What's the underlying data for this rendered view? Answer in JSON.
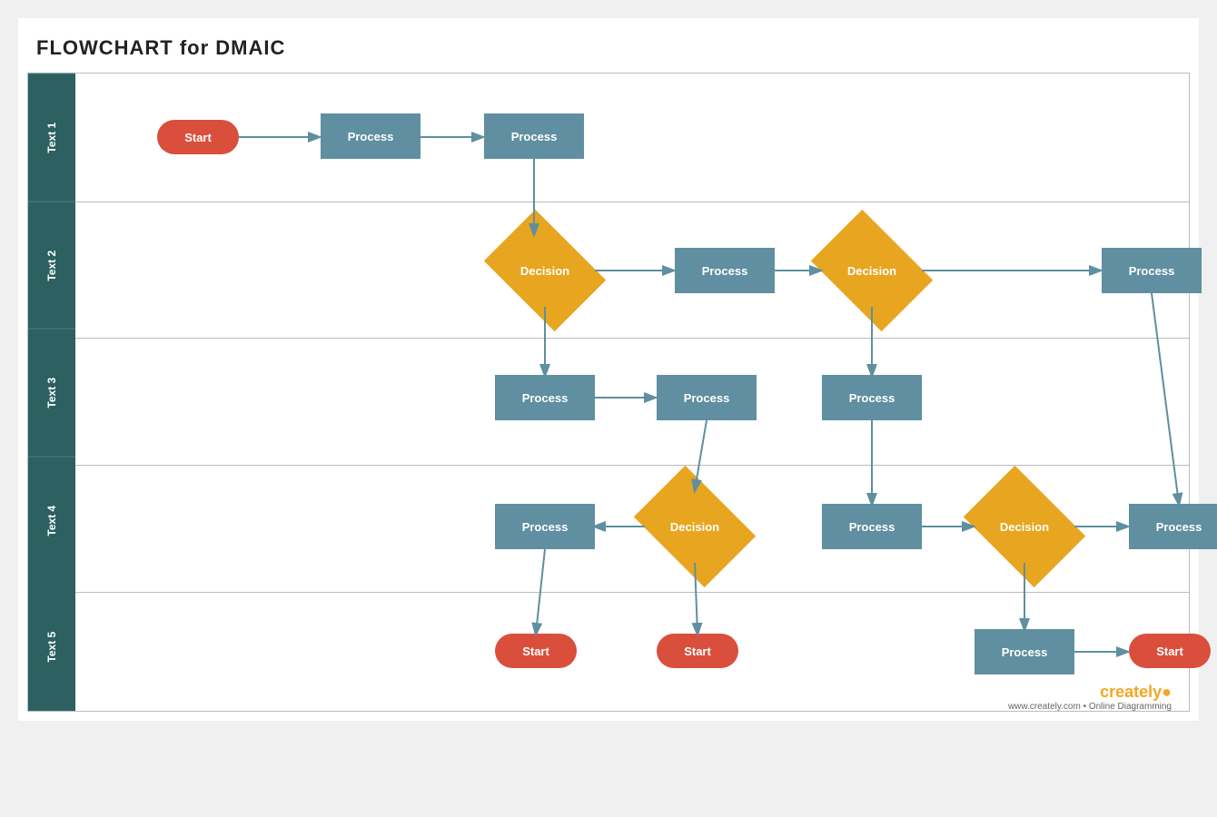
{
  "title": "FLOWCHART for DMAIC",
  "sidebar": {
    "labels": [
      "Text 1",
      "Text 2",
      "Text 3",
      "Text 4",
      "Text 5"
    ]
  },
  "shapes": {
    "start_label": "Start",
    "process_label": "Process",
    "decision_label": "Decision"
  },
  "creately": {
    "brand": "creately",
    "highlight": ".",
    "sub": "www.creately.com • Online Diagramming"
  }
}
